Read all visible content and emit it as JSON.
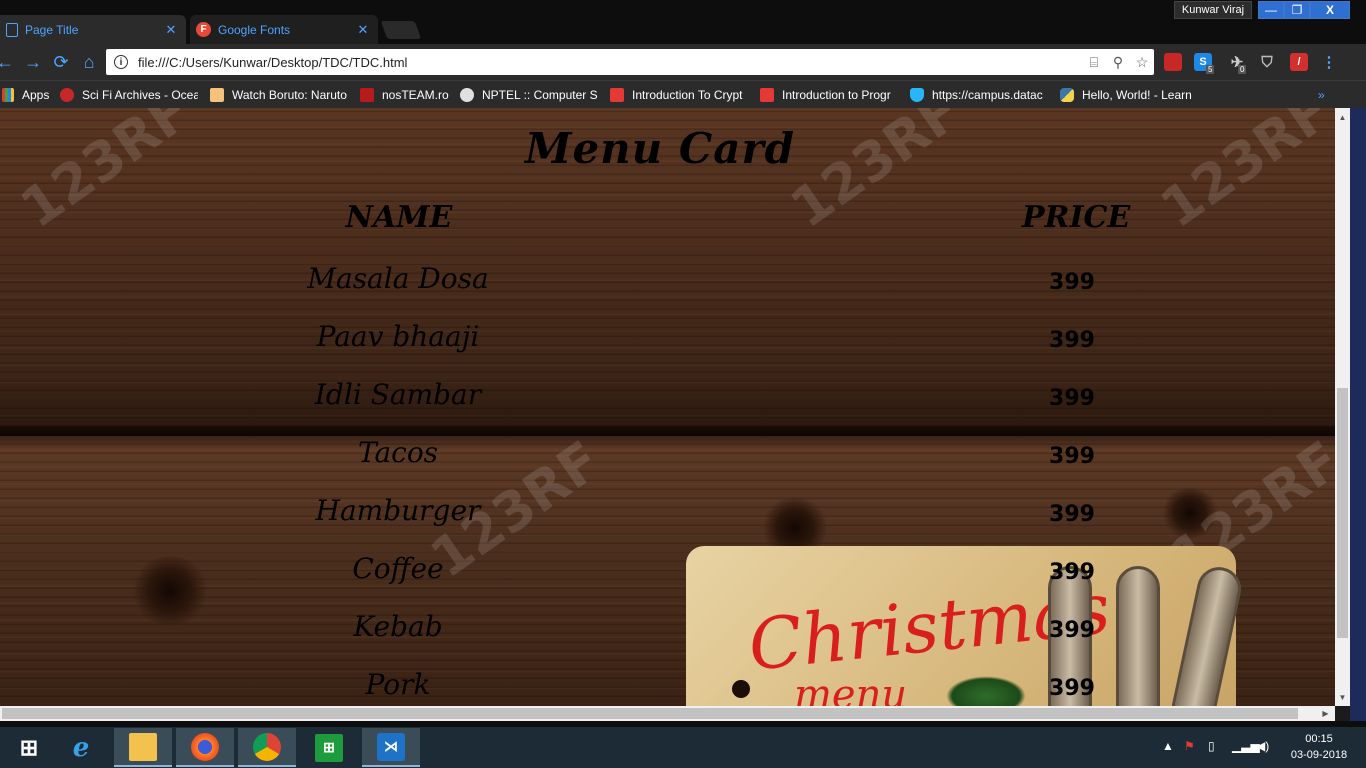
{
  "browser": {
    "tabs": [
      {
        "label": "Page Title",
        "close": "✕"
      },
      {
        "label": "Google Fonts",
        "icon_letter": "F",
        "close": "✕"
      }
    ],
    "profile_name": "Kunwar Viraj",
    "window_controls": {
      "minimize": "—",
      "maximize": "❐",
      "close": "X"
    },
    "url": "file:///C:/Users/Kunwar/Desktop/TDC/TDC.html",
    "extension_badges": {
      "s": "5",
      "pin": "0"
    },
    "bookmarks": [
      {
        "label": "Apps"
      },
      {
        "label": "Sci Fi Archives - Ocea"
      },
      {
        "label": "Watch Boruto: Naruto"
      },
      {
        "label": "nosTEAM.ro"
      },
      {
        "label": "NPTEL :: Computer Sc"
      },
      {
        "label": "Introduction To Crypt"
      },
      {
        "label": "Introduction to Progr"
      },
      {
        "label": "https://campus.datac"
      },
      {
        "label": "Hello, World! - Learn"
      }
    ]
  },
  "page": {
    "heading": "Menu Card",
    "columns": {
      "name": "NAME",
      "price": "PRICE"
    },
    "items": [
      {
        "name": "Masala Dosa",
        "price": "399"
      },
      {
        "name": "Paav bhaaji",
        "price": "399"
      },
      {
        "name": "Idli Sambar",
        "price": "399"
      },
      {
        "name": "Tacos",
        "price": "399"
      },
      {
        "name": "Hamburger",
        "price": "399"
      },
      {
        "name": "Coffee",
        "price": "399"
      },
      {
        "name": "Kebab",
        "price": "399"
      },
      {
        "name": "Pork",
        "price": "399"
      }
    ],
    "board_text": "Christmas",
    "board_subtext": "menu",
    "watermark": "123RF"
  },
  "taskbar": {
    "apps": [
      "start-icon",
      "ie-icon",
      "file-explorer-icon",
      "firefox-icon",
      "chrome-icon",
      "store-icon",
      "vscode-icon"
    ],
    "time": "00:15",
    "date": "03-09-2018"
  },
  "colors": {
    "accent": "#4fa3ff",
    "titlebar_button": "#2f6fd1",
    "taskbar": "#1d2b36"
  }
}
